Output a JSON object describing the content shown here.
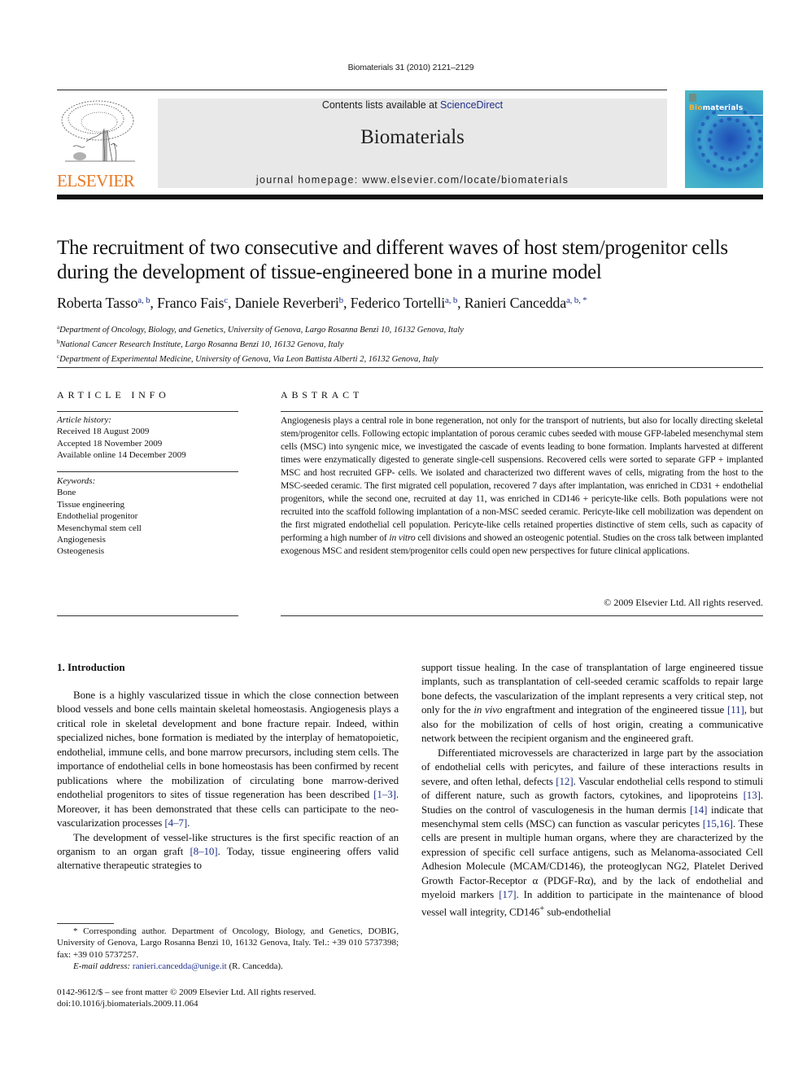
{
  "header": {
    "citation": "Biomaterials 31 (2010) 2121–2129",
    "publisher": "ELSEVIER",
    "contents_prefix": "Contents lists available at ",
    "contents_link": "ScienceDirect",
    "journal_name": "Biomaterials",
    "homepage": "journal homepage: www.elsevier.com/locate/biomaterials",
    "cover_title_accent": "Bio",
    "cover_title_rest": "materials",
    "colors": {
      "publisher_orange": "#e87722",
      "link_blue": "#1f2f8a",
      "box_gray": "#e8e8e8"
    }
  },
  "article": {
    "title": "The recruitment of two consecutive and different waves of host stem/progenitor cells during the development of tissue-engineered bone in a murine model",
    "authors": [
      {
        "name": "Roberta Tasso",
        "sup": "a, b",
        "sep": ", "
      },
      {
        "name": "Franco Fais",
        "sup": "c",
        "sep": ", "
      },
      {
        "name": "Daniele Reverberi",
        "sup": "b",
        "sep": ", "
      },
      {
        "name": "Federico Tortelli",
        "sup": "a, b",
        "sep": ", "
      },
      {
        "name": "Ranieri Cancedda",
        "sup": "a, b, *",
        "sep": ""
      }
    ],
    "affiliations": [
      {
        "key": "a",
        "text": "Department of Oncology, Biology, and Genetics, University of Genova, Largo Rosanna Benzi 10, 16132 Genova, Italy"
      },
      {
        "key": "b",
        "text": "National Cancer Research Institute, Largo Rosanna Benzi 10, 16132 Genova, Italy"
      },
      {
        "key": "c",
        "text": "Department of Experimental Medicine, University of Genova, Via Leon Battista Alberti 2, 16132 Genova, Italy"
      }
    ]
  },
  "article_info": {
    "label": "ARTICLE INFO",
    "history_heading": "Article history:",
    "history": [
      "Received 18 August 2009",
      "Accepted 18 November 2009",
      "Available online 14 December 2009"
    ],
    "keywords_heading": "Keywords:",
    "keywords": [
      "Bone",
      "Tissue engineering",
      "Endothelial progenitor",
      "Mesenchymal stem cell",
      "Angiogenesis",
      "Osteogenesis"
    ]
  },
  "abstract": {
    "label": "ABSTRACT",
    "text_before_italic": "Angiogenesis plays a central role in bone regeneration, not only for the transport of nutrients, but also for locally directing skeletal stem/progenitor cells. Following ectopic implantation of porous ceramic cubes seeded with mouse GFP-labeled mesenchymal stem cells (MSC) into syngenic mice, we investigated the cascade of events leading to bone formation. Implants harvested at different times were enzymatically digested to generate single-cell suspensions. Recovered cells were sorted to separate GFP + implanted MSC and host recruited GFP- cells. We isolated and characterized two different waves of cells, migrating from the host to the MSC-seeded ceramic. The first migrated cell population, recovered 7 days after implantation, was enriched in CD31 + endothelial progenitors, while the second one, recruited at day 11, was enriched in CD146 + pericyte-like cells. Both populations were not recruited into the scaffold following implantation of a non-MSC seeded ceramic. Pericyte-like cell mobilization was dependent on the first migrated endothelial cell population. Pericyte-like cells retained properties distinctive of stem cells, such as capacity of performing a high number of ",
    "italic": "in vitro",
    "text_after_italic": " cell divisions and showed an osteogenic potential. Studies on the cross talk between implanted exogenous MSC and resident stem/progenitor cells could open new perspectives for future clinical applications.",
    "copyright": "© 2009 Elsevier Ltd. All rights reserved."
  },
  "body": {
    "section_heading": "1.  Introduction",
    "left": {
      "p1_a": "Bone is a highly vascularized tissue in which the close connection between blood vessels and bone cells maintain skeletal homeostasis. Angiogenesis plays a critical role in skeletal development and bone fracture repair. Indeed, within specialized niches, bone formation is mediated by the interplay of hematopoietic, endothelial, immune cells, and bone marrow precursors, including stem cells. The importance of endothelial cells in bone homeostasis has been confirmed by recent publications where the mobilization of circulating bone marrow-derived endothelial progenitors to sites of tissue regeneration has been described ",
      "ref1": "[1–3]",
      "p1_b": ". Moreover, it has been demonstrated that these cells can participate to the neo-vascularization processes ",
      "ref2": "[4–7]",
      "p1_c": ".",
      "p2_a": "The development of vessel-like structures is the first specific reaction of an organism to an organ graft ",
      "ref3": "[8–10]",
      "p2_b": ". Today, tissue engineering offers valid alternative therapeutic strategies to"
    },
    "right": {
      "p1_a": "support tissue healing. In the case of transplantation of large engineered tissue implants, such as transplantation of cell-seeded ceramic scaffolds to repair large bone defects, the vascularization of the implant represents a very critical step, not only for the ",
      "p1_italic": "in vivo",
      "p1_b": " engraftment and integration of the engineered tissue ",
      "ref11": "[11]",
      "p1_c": ", but also for the mobilization of cells of host origin, creating a communicative network between the recipient organism and the engineered graft.",
      "p2_a": "Differentiated microvessels are characterized in large part by the association of endothelial cells with pericytes, and failure of these interactions results in severe, and often lethal, defects ",
      "ref12": "[12]",
      "p2_b": ". Vascular endothelial cells respond to stimuli of different nature, such as growth factors, cytokines, and lipoproteins ",
      "ref13": "[13]",
      "p2_c": ". Studies on the control of vasculogenesis in the human dermis ",
      "ref14": "[14]",
      "p2_d": " indicate that mesenchymal stem cells (MSC) can function as vascular pericytes ",
      "ref15": "[15,16]",
      "p2_e": ". These cells are present in multiple human organs, where they are characterized by the expression of specific cell surface antigens, such as Melanoma-associated Cell Adhesion Molecule (MCAM/CD146), the proteoglycan NG2, Platelet Derived Growth Factor-Receptor α (PDGF-Rα), and by the lack of endothelial and myeloid markers ",
      "ref17": "[17]",
      "p2_f": ". In addition to participate in the maintenance of blood vessel wall integrity, CD146",
      "p2_sup": "+",
      "p2_g": " sub-endothelial"
    }
  },
  "footnote": {
    "corresponding": "* Corresponding author. Department of Oncology, Biology, and Genetics, DOBIG, University of Genova, Largo Rosanna Benzi 10, 16132 Genova, Italy. Tel.: +39 010 5737398; fax: +39 010 5737257.",
    "email_label": "E-mail address: ",
    "email": "ranieri.cancedda@unige.it",
    "email_suffix": " (R. Cancedda).",
    "front_matter": "0142-9612/$ – see front matter © 2009 Elsevier Ltd. All rights reserved.",
    "doi": "doi:10.1016/j.biomaterials.2009.11.064"
  }
}
